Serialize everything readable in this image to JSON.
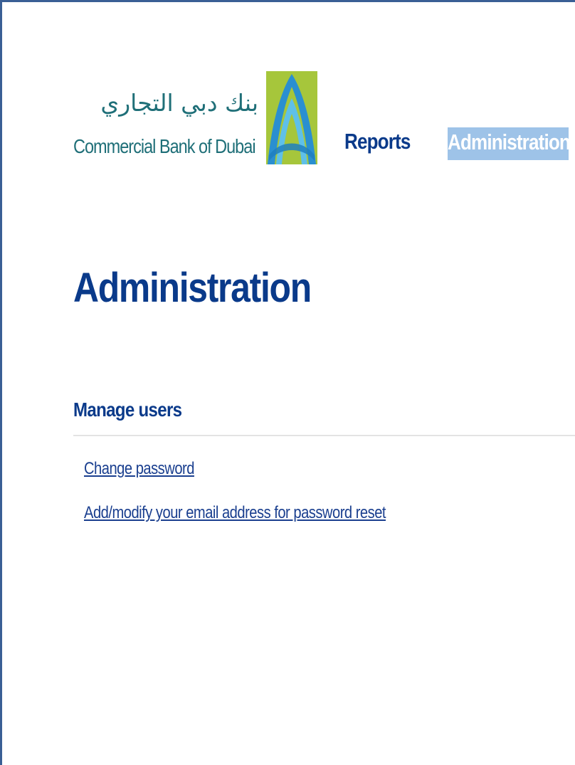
{
  "header": {
    "logo": {
      "arabic_text": "بنك دبي التجاري",
      "english_text": "Commercial Bank of Dubai",
      "colors": {
        "text": "#1f6f78",
        "mark_green": "#a6c63b",
        "mark_blue": "#2a8fd0"
      }
    },
    "nav": {
      "reports_label": "Reports",
      "administration_label": "Administration"
    }
  },
  "main": {
    "title": "Administration",
    "section": {
      "heading": "Manage users",
      "links": [
        {
          "label": "Change password"
        },
        {
          "label": "Add/modify your email address for password reset"
        }
      ]
    }
  },
  "colors": {
    "primary_text": "#0a3a8a",
    "active_nav_bg": "#9ec3e8",
    "link": "#1a3f8f",
    "frame_border": "#3a5f95"
  }
}
